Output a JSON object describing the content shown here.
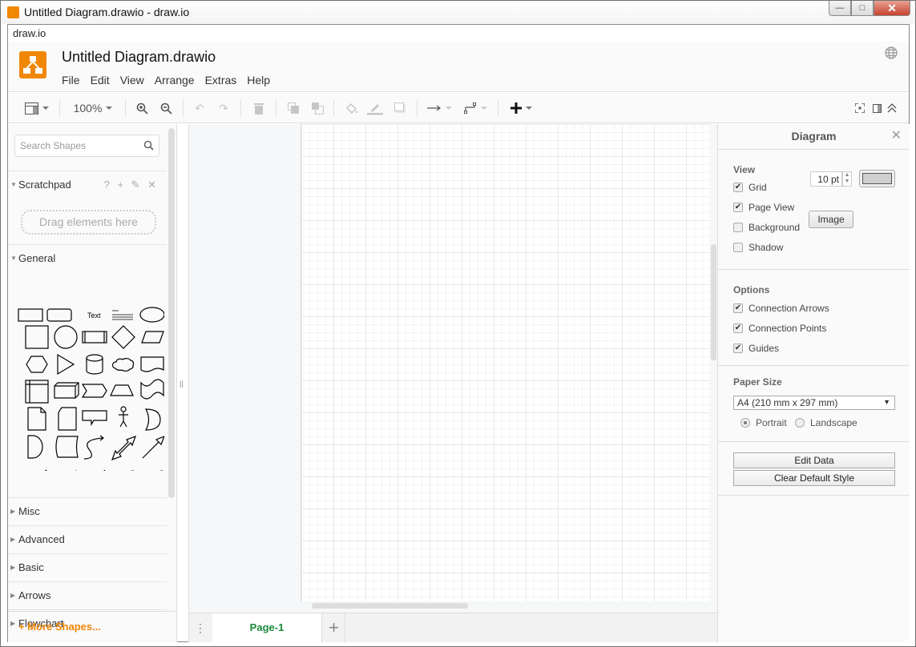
{
  "window": {
    "title": "Untitled Diagram.drawio - draw.io",
    "controls": {
      "minimize": "—",
      "maximize": "□",
      "close": "✕"
    }
  },
  "urlbar": {
    "text": "draw.io"
  },
  "header": {
    "doc_title": "Untitled Diagram.drawio",
    "menu": [
      "File",
      "Edit",
      "View",
      "Arrange",
      "Extras",
      "Help"
    ],
    "language_icon": "globe-icon"
  },
  "toolbar": {
    "zoom_level": "100%",
    "items": [
      "format-panel",
      "zoom",
      "zoom-in",
      "zoom-out",
      "undo",
      "redo",
      "delete",
      "to-front",
      "to-back",
      "fill-color",
      "line-color",
      "shadow",
      "connection",
      "waypoints",
      "insert"
    ],
    "right_items": [
      "fullscreen",
      "format-toggle",
      "collapse"
    ]
  },
  "sidebar": {
    "search_placeholder": "Search Shapes",
    "scratchpad": {
      "label": "Scratchpad",
      "icons": "? + ✎ ✕",
      "dropzone": "Drag elements here"
    },
    "general": {
      "label": "General"
    },
    "sections": [
      "Misc",
      "Advanced",
      "Basic",
      "Arrows",
      "Flowchart"
    ],
    "text_shape_label": "Text",
    "more_shapes": "More Shapes..."
  },
  "pages": {
    "menu_icon": "⋮",
    "tabs": [
      {
        "label": "Page-1",
        "active": true
      }
    ],
    "add": "+"
  },
  "format_panel": {
    "title": "Diagram",
    "close": "✕",
    "view": {
      "heading": "View",
      "grid": {
        "label": "Grid",
        "checked": true,
        "size": "10 pt"
      },
      "page_view": {
        "label": "Page View",
        "checked": true
      },
      "background": {
        "label": "Background",
        "checked": false,
        "button": "Image"
      },
      "shadow": {
        "label": "Shadow",
        "checked": false
      }
    },
    "options": {
      "heading": "Options",
      "connection_arrows": {
        "label": "Connection Arrows",
        "checked": true
      },
      "connection_points": {
        "label": "Connection Points",
        "checked": true
      },
      "guides": {
        "label": "Guides",
        "checked": true
      }
    },
    "paper": {
      "heading": "Paper Size",
      "selected": "A4 (210 mm x 297 mm)",
      "portrait": "Portrait",
      "landscape": "Landscape",
      "orientation": "portrait"
    },
    "buttons": {
      "edit_data": "Edit Data",
      "clear_style": "Clear Default Style"
    }
  },
  "colors": {
    "brand": "#f08705",
    "active_tab": "#1a8a3a",
    "grid_color": "#d0d0d0"
  }
}
